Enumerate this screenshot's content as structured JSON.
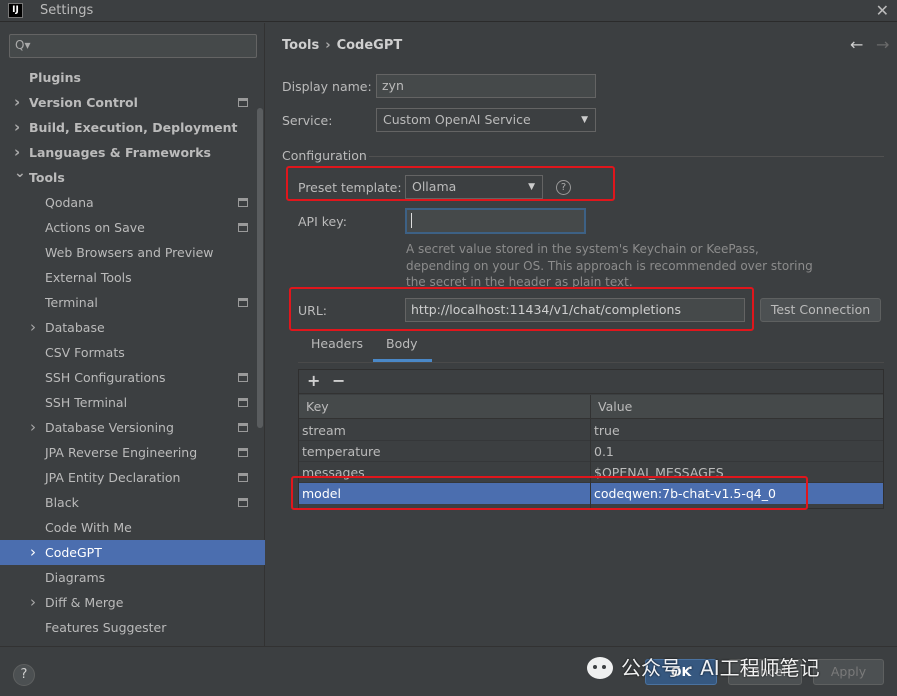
{
  "window": {
    "title": "Settings",
    "app_icon_label": "IJ",
    "close_glyph": "✕"
  },
  "sidebar": {
    "search_placeholder": "Q▾",
    "items": [
      {
        "label": "Plugins",
        "level": 0,
        "bold": true,
        "expandable": false
      },
      {
        "label": "Version Control",
        "level": 0,
        "bold": true,
        "expandable": true,
        "expanded": false,
        "project_icon": true
      },
      {
        "label": "Build, Execution, Deployment",
        "level": 0,
        "bold": true,
        "expandable": true,
        "expanded": false
      },
      {
        "label": "Languages & Frameworks",
        "level": 0,
        "bold": true,
        "expandable": true,
        "expanded": false
      },
      {
        "label": "Tools",
        "level": 0,
        "bold": true,
        "expandable": true,
        "expanded": true
      },
      {
        "label": "Qodana",
        "level": 1,
        "project_icon": true
      },
      {
        "label": "Actions on Save",
        "level": 1,
        "project_icon": true
      },
      {
        "label": "Web Browsers and Preview",
        "level": 1
      },
      {
        "label": "External Tools",
        "level": 1
      },
      {
        "label": "Terminal",
        "level": 1,
        "project_icon": true
      },
      {
        "label": "Database",
        "level": 1,
        "expandable": true,
        "expanded": false
      },
      {
        "label": "CSV Formats",
        "level": 1
      },
      {
        "label": "SSH Configurations",
        "level": 1,
        "project_icon": true
      },
      {
        "label": "SSH Terminal",
        "level": 1,
        "project_icon": true
      },
      {
        "label": "Database Versioning",
        "level": 1,
        "expandable": true,
        "expanded": false,
        "project_icon": true
      },
      {
        "label": "JPA Reverse Engineering",
        "level": 1,
        "project_icon": true
      },
      {
        "label": "JPA Entity Declaration",
        "level": 1,
        "project_icon": true
      },
      {
        "label": "Black",
        "level": 1,
        "project_icon": true
      },
      {
        "label": "Code With Me",
        "level": 1
      },
      {
        "label": "CodeGPT",
        "level": 1,
        "expandable": true,
        "expanded": false,
        "selected": true
      },
      {
        "label": "Diagrams",
        "level": 1
      },
      {
        "label": "Diff & Merge",
        "level": 1,
        "expandable": true,
        "expanded": false
      },
      {
        "label": "Features Suggester",
        "level": 1
      }
    ]
  },
  "header": {
    "crumb_parent": "Tools",
    "crumb_separator": "›",
    "crumb_current": "CodeGPT",
    "back_glyph": "←",
    "forward_glyph": "→"
  },
  "form": {
    "display_name_label": "Display name:",
    "display_name_value": "zyn",
    "service_label": "Service:",
    "service_value": "Custom OpenAI Service",
    "configuration_title": "Configuration",
    "preset_template_label": "Preset template:",
    "preset_template_value": "Ollama",
    "help_glyph": "?",
    "api_key_label": "API key:",
    "api_key_value": "",
    "api_key_hint": "A secret value stored in the system's Keychain or KeePass, depending on your OS. This approach is recommended over storing the secret in the header as plain text.",
    "url_label": "URL:",
    "url_value": "http://localhost:11434/v1/chat/completions",
    "test_connection_label": "Test Connection",
    "dropdown_glyph": "▼"
  },
  "tabs": [
    {
      "label": "Headers",
      "active": false
    },
    {
      "label": "Body",
      "active": true
    }
  ],
  "body_table": {
    "add_glyph": "+",
    "remove_glyph": "−",
    "columns": [
      "Key",
      "Value"
    ],
    "rows": [
      {
        "key": "stream",
        "value": "true",
        "selected": false
      },
      {
        "key": "temperature",
        "value": "0.1",
        "selected": false
      },
      {
        "key": "messages",
        "value": "$OPENAI_MESSAGES",
        "selected": false
      },
      {
        "key": "model",
        "value": "codeqwen:7b-chat-v1.5-q4_0",
        "selected": true
      }
    ]
  },
  "footer": {
    "help_label": "?",
    "ok_label": "OK",
    "cancel_label": "Cancel",
    "apply_label": "Apply",
    "watermark": "公众号 · AI工程师笔记"
  },
  "colors": {
    "accent_selection": "#4b6eaf",
    "highlight_annotation": "#e0161c",
    "tab_underline": "#4a88c7"
  }
}
